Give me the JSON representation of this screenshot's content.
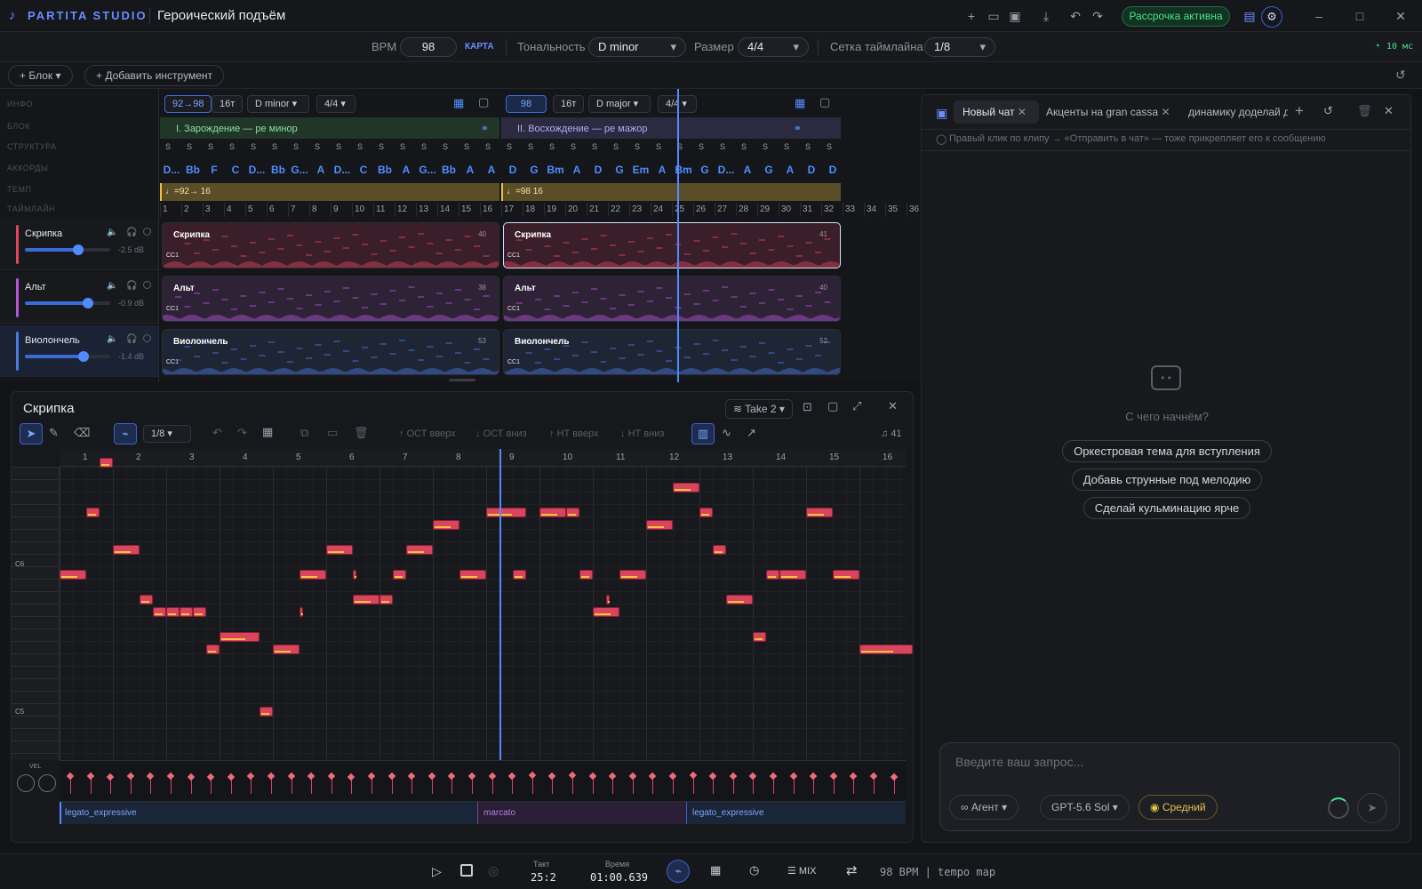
{
  "app": {
    "logo": "PARTITA STUDIO",
    "project_title": "Героический подъём",
    "subscription": "Рассрочка активна"
  },
  "header": {
    "bpm_label": "BPM",
    "bpm_value": "98",
    "map_label": "КАРТА",
    "key_label": "Тональность",
    "key_value": "D minor",
    "size_label": "Размер",
    "size_value": "4/4",
    "grid_label": "Сетка таймлайна",
    "grid_value": "1/8",
    "latency": "10 мс"
  },
  "toolbar3": {
    "block_label": "Блок",
    "add_instrument_label": "Добавить инструмент"
  },
  "arrangement": {
    "row_labels": [
      "ИНФО",
      "БЛОК",
      "СТРУКТУРА",
      "АККОРДЫ",
      "ТЕМП",
      "ТАЙМЛАЙН"
    ],
    "block1": {
      "tempo": "92→98",
      "notes": "16т",
      "key": "D minor",
      "meter": "4/4",
      "title": "I. Зарождение — ре минор",
      "tempo_marker": "♩=92→ 16",
      "chords": [
        "D...",
        "Bb",
        "F",
        "C",
        "D...",
        "Bb",
        "G...",
        "A",
        "D...",
        "C",
        "Bb",
        "A",
        "G...",
        "Bb",
        "A",
        "A"
      ]
    },
    "block2": {
      "tempo": "98",
      "notes": "16т",
      "key": "D major",
      "meter": "4/4",
      "title": "II. Восхождение — ре мажор",
      "tempo_marker": "♩=98 16",
      "chords": [
        "D",
        "G",
        "Bm",
        "A",
        "D",
        "G",
        "Em",
        "A",
        "Bm",
        "G",
        "D...",
        "A",
        "G",
        "A",
        "D",
        "D"
      ]
    },
    "structure_marker": "S",
    "bars": [
      "1",
      "2",
      "3",
      "4",
      "5",
      "6",
      "7",
      "8",
      "9",
      "10",
      "11",
      "12",
      "13",
      "14",
      "15",
      "16",
      "17",
      "18",
      "19",
      "20",
      "21",
      "22",
      "23",
      "24",
      "25",
      "26",
      "27",
      "28",
      "29",
      "30",
      "31",
      "32",
      "33",
      "34",
      "35",
      "36"
    ],
    "tracks": [
      {
        "name": "Скрипка",
        "db": "-2.5 dB",
        "color": "#e0475e",
        "clip_bg": "#3a1e29",
        "clip_count_1": "40",
        "clip_count_2": "41",
        "vol": 0.62
      },
      {
        "name": "Альт",
        "db": "-0.9 dB",
        "color": "#b357d6",
        "clip_bg": "#2e2236",
        "clip_count_1": "38",
        "clip_count_2": "40",
        "vol": 0.74
      },
      {
        "name": "Виолончель",
        "db": "-1.4 dB",
        "color": "#4a7be0",
        "clip_bg": "#1e2636",
        "clip_count_1": "53",
        "clip_count_2": "52",
        "vol": 0.69
      }
    ],
    "clip_cc": "CC1"
  },
  "editor": {
    "title": "Скрипка",
    "take": "Take 2",
    "grid": "1/8",
    "tools": {
      "oct_up": "ОСТ вверх",
      "oct_down": "ОСТ вниз",
      "ht_up": "НТ вверх",
      "ht_down": "НТ вниз"
    },
    "note_count": "41",
    "key_labels": {
      "c6": "C6",
      "c5": "C5"
    },
    "bars": [
      "1",
      "2",
      "3",
      "4",
      "5",
      "6",
      "7",
      "8",
      "9",
      "10",
      "11",
      "12",
      "13",
      "14",
      "15",
      "16"
    ],
    "vel_label": "VEL",
    "articulations": [
      {
        "label": "legato_expressive"
      },
      {
        "label": "marcato"
      },
      {
        "label": "legato_expressive"
      }
    ],
    "notes": [
      {
        "b": 0,
        "p": 14,
        "d": 0.5
      },
      {
        "b": 0.5,
        "p": 19,
        "d": 0.25
      },
      {
        "b": 0.75,
        "p": 23,
        "d": 0.25
      },
      {
        "b": 1,
        "p": 16,
        "d": 0.5
      },
      {
        "b": 1.5,
        "p": 12,
        "d": 0.25
      },
      {
        "b": 1.75,
        "p": 11,
        "d": 0.25
      },
      {
        "b": 2,
        "p": 11,
        "d": 0.25
      },
      {
        "b": 2.25,
        "p": 11,
        "d": 0.25
      },
      {
        "b": 2.5,
        "p": 11,
        "d": 0.25
      },
      {
        "b": 2.75,
        "p": 8,
        "d": 0.25
      },
      {
        "b": 3,
        "p": 9,
        "d": 0.75
      },
      {
        "b": 3.75,
        "p": 3,
        "d": 0.25
      },
      {
        "b": 4,
        "p": 8,
        "d": 0.5
      },
      {
        "b": 4.5,
        "p": 11,
        "d": 0.06
      },
      {
        "b": 4.5,
        "p": 14,
        "d": 0.5
      },
      {
        "b": 5,
        "p": 16,
        "d": 0.5
      },
      {
        "b": 5.5,
        "p": 14,
        "d": 0.06
      },
      {
        "b": 5.5,
        "p": 12,
        "d": 0.5
      },
      {
        "b": 6,
        "p": 12,
        "d": 0.25
      },
      {
        "b": 6.25,
        "p": 14,
        "d": 0.25
      },
      {
        "b": 6.5,
        "p": 16,
        "d": 0.5
      },
      {
        "b": 7,
        "p": 18,
        "d": 0.5
      },
      {
        "b": 7.5,
        "p": 14,
        "d": 0.5
      },
      {
        "b": 8,
        "p": 19,
        "d": 0.75
      },
      {
        "b": 8.5,
        "p": 14,
        "d": 0.25
      },
      {
        "b": 9,
        "p": 19,
        "d": 0.5
      },
      {
        "b": 9.5,
        "p": 19,
        "d": 0.25
      },
      {
        "b": 9.75,
        "p": 14,
        "d": 0.25
      },
      {
        "b": 10,
        "p": 11,
        "d": 0.5
      },
      {
        "b": 10.25,
        "p": 12,
        "d": 0.06
      },
      {
        "b": 10.5,
        "p": 14,
        "d": 0.5
      },
      {
        "b": 11,
        "p": 18,
        "d": 0.5
      },
      {
        "b": 11.5,
        "p": 21,
        "d": 0.5
      },
      {
        "b": 12,
        "p": 19,
        "d": 0.25
      },
      {
        "b": 12.25,
        "p": 16,
        "d": 0.25
      },
      {
        "b": 12.5,
        "p": 12,
        "d": 0.5
      },
      {
        "b": 13,
        "p": 9,
        "d": 0.25
      },
      {
        "b": 13.25,
        "p": 14,
        "d": 0.25
      },
      {
        "b": 13.5,
        "p": 14,
        "d": 0.5
      },
      {
        "b": 14,
        "p": 19,
        "d": 0.5
      },
      {
        "b": 14.5,
        "p": 14,
        "d": 0.5
      },
      {
        "b": 15,
        "p": 8,
        "d": 1
      }
    ],
    "velocities": [
      84,
      84,
      82,
      83,
      84,
      83,
      82,
      81,
      82,
      83,
      84,
      83,
      84,
      83,
      82,
      84,
      83,
      84,
      85,
      83,
      84,
      86,
      86,
      88,
      86,
      87,
      86,
      85,
      84,
      86,
      85,
      87,
      86,
      85,
      84,
      85,
      86,
      84,
      83,
      85,
      84,
      82
    ]
  },
  "chat": {
    "tabs": [
      {
        "label": "Новый чат"
      },
      {
        "label": "Акценты на gran cassa"
      },
      {
        "label": "динамику доделай дл"
      }
    ],
    "hint": "Правый клик по клипу → «Отправить в чат» — тоже прикрепляет его к сообщению",
    "empty_title": "С чего начнём?",
    "suggestions": [
      "Оркестровая тема для вступления",
      "Добавь струнные под мелодию",
      "Сделай кульминацию ярче"
    ],
    "input_placeholder": "Введите ваш запрос...",
    "mode": "Агент",
    "model": "GPT-5.6 Sol",
    "effort": "Средний"
  },
  "transport": {
    "bar_label": "Такт",
    "bar_value": "25:2",
    "time_label": "Время",
    "time_value": "01:00.639",
    "mix_label": "MIX",
    "status": "98 BPM | tempo map"
  }
}
